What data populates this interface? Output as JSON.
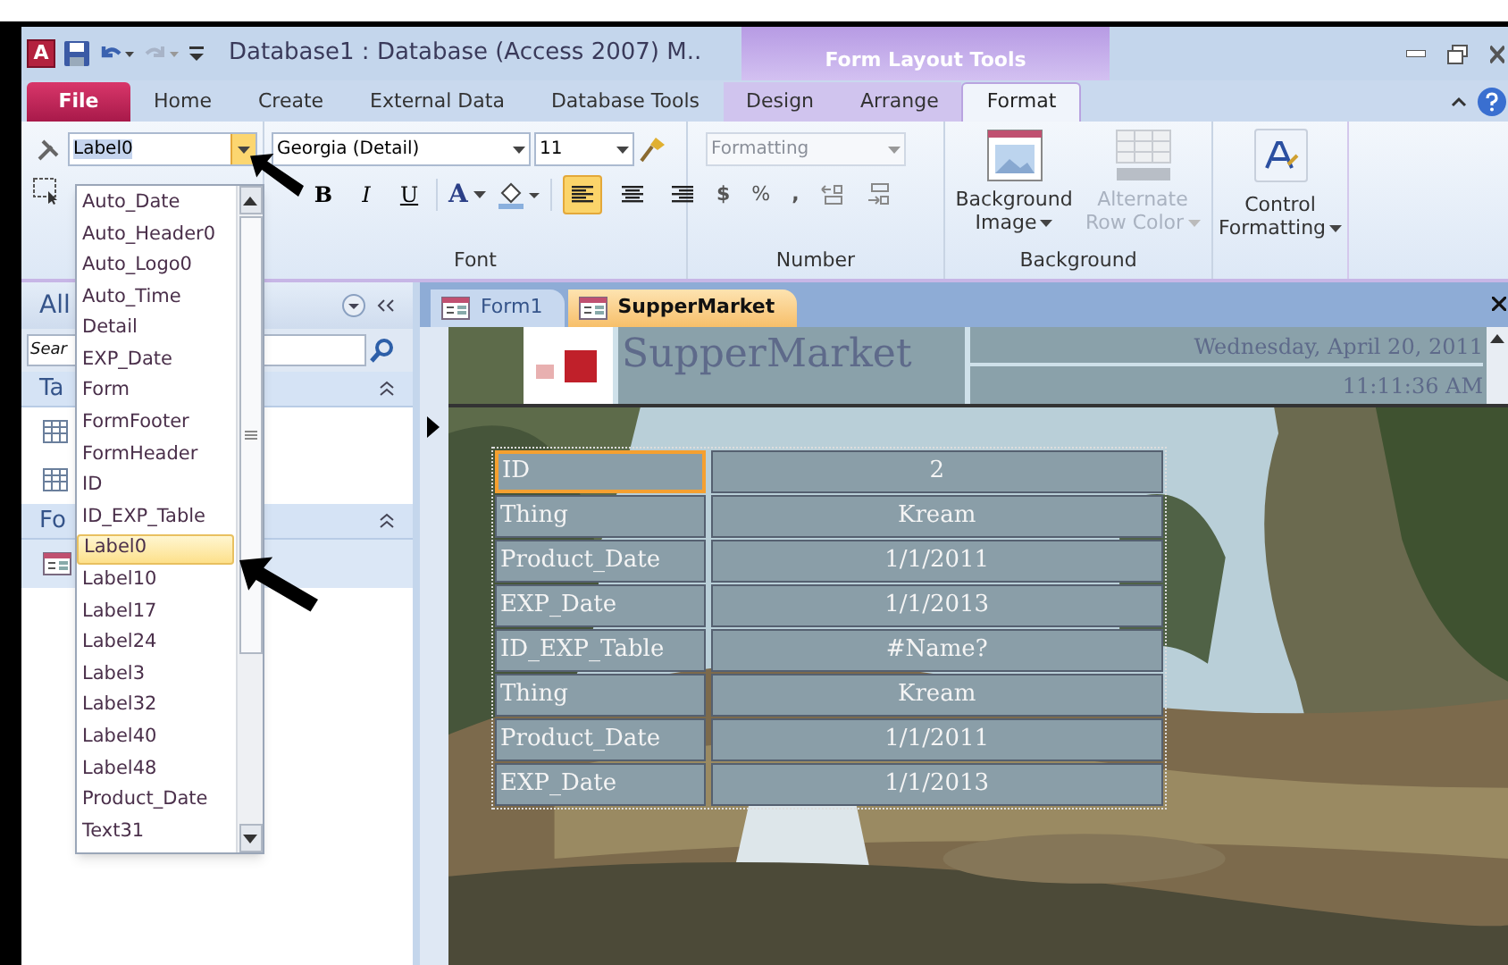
{
  "app_icon": "A",
  "window": {
    "title": "Database1 : Database (Access 2007) M.."
  },
  "contextual_tab_group": "Form Layout Tools",
  "ribbon_tabs": [
    {
      "label": "File",
      "kind": "file",
      "selected": false
    },
    {
      "label": "Home",
      "kind": "tab",
      "selected": false
    },
    {
      "label": "Create",
      "kind": "tab",
      "selected": false
    },
    {
      "label": "External Data",
      "kind": "tab",
      "selected": false
    },
    {
      "label": "Database Tools",
      "kind": "tab",
      "selected": false
    },
    {
      "label": "Design",
      "kind": "context",
      "selected": false
    },
    {
      "label": "Arrange",
      "kind": "context",
      "selected": false
    },
    {
      "label": "Format",
      "kind": "context",
      "selected": true
    }
  ],
  "selection": {
    "object_value": "Label0",
    "open": true,
    "options": [
      {
        "label": "Auto_Date",
        "selected": false
      },
      {
        "label": "Auto_Header0",
        "selected": false
      },
      {
        "label": "Auto_Logo0",
        "selected": false
      },
      {
        "label": "Auto_Time",
        "selected": false
      },
      {
        "label": "Detail",
        "selected": false
      },
      {
        "label": "EXP_Date",
        "selected": false
      },
      {
        "label": "Form",
        "selected": false
      },
      {
        "label": "FormFooter",
        "selected": false
      },
      {
        "label": "FormHeader",
        "selected": false
      },
      {
        "label": "ID",
        "selected": false
      },
      {
        "label": "ID_EXP_Table",
        "selected": false
      },
      {
        "label": "Label0",
        "selected": true
      },
      {
        "label": "Label10",
        "selected": false
      },
      {
        "label": "Label17",
        "selected": false
      },
      {
        "label": "Label24",
        "selected": false
      },
      {
        "label": "Label3",
        "selected": false
      },
      {
        "label": "Label32",
        "selected": false
      },
      {
        "label": "Label40",
        "selected": false
      },
      {
        "label": "Label48",
        "selected": false
      },
      {
        "label": "Product_Date",
        "selected": false
      },
      {
        "label": "Text31",
        "selected": false
      }
    ]
  },
  "font_group": {
    "label": "Font",
    "font": "Georgia (Detail)",
    "size": "11",
    "bold": "B",
    "italic": "I",
    "underline": "U",
    "font_color": "A",
    "align": [
      {
        "kind": "left",
        "selected": true
      },
      {
        "kind": "center",
        "selected": false
      },
      {
        "kind": "right",
        "selected": false
      }
    ]
  },
  "number_group": {
    "label": "Number",
    "format_placeholder": "Formatting",
    "currency": "$",
    "percent": "%",
    "comma": ","
  },
  "background_group": {
    "label": "Background",
    "buttons": [
      {
        "label": "Background Image",
        "disabled": false
      },
      {
        "label": "Alternate Row Color",
        "disabled": true
      }
    ]
  },
  "control_formatting": {
    "label": "Control Formatting"
  },
  "nav_pane": {
    "header": "All",
    "search_placeholder": "Sear",
    "sections": [
      {
        "label": "Ta",
        "items": [
          {
            "kind": "table"
          },
          {
            "kind": "table"
          }
        ]
      },
      {
        "label": "Fo",
        "items": [
          {
            "kind": "form"
          }
        ]
      }
    ]
  },
  "document_tabs": [
    {
      "label": "Form1",
      "selected": false
    },
    {
      "label": "SupperMarket",
      "selected": true
    }
  ],
  "form": {
    "title": "SupperMarket",
    "date": "Wednesday, April 20, 2011",
    "time": "11:11:36 AM",
    "fields": [
      {
        "label": "ID",
        "value": "2",
        "selected": true
      },
      {
        "label": "Thing",
        "value": "Kream",
        "selected": false
      },
      {
        "label": "Product_Date",
        "value": "1/1/2011",
        "selected": false
      },
      {
        "label": "EXP_Date",
        "value": "1/1/2013",
        "selected": false
      },
      {
        "label": "ID_EXP_Table",
        "value": "#Name?",
        "selected": false
      },
      {
        "label": "Thing",
        "value": "Kream",
        "selected": false
      },
      {
        "label": "Product_Date",
        "value": "1/1/2011",
        "selected": false
      },
      {
        "label": "EXP_Date",
        "value": "1/1/2013",
        "selected": false
      }
    ]
  }
}
